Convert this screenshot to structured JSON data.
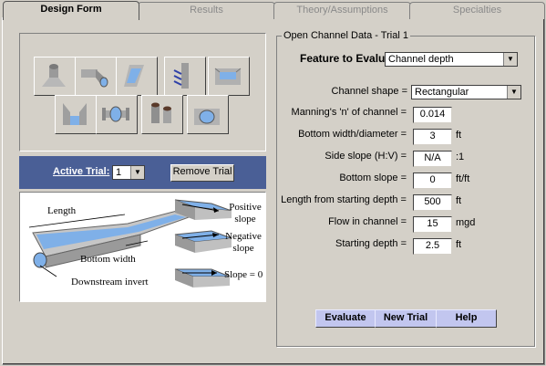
{
  "tabs": [
    {
      "label": "Design Form",
      "active": true
    },
    {
      "label": "Results",
      "active": false
    },
    {
      "label": "Theory/Assumptions",
      "active": false
    },
    {
      "label": "Specialties",
      "active": false
    }
  ],
  "icons": {
    "row1": [
      "pipe-outlet-icon",
      "angled-pipe-icon",
      "open-channel-icon",
      "weir-plate-icon",
      "box-channel-icon"
    ],
    "row2": [
      "flume-icon",
      "pipe-junction-icon",
      "manhole-icon",
      "culvert-icon"
    ]
  },
  "active_trial": {
    "label": "Active Trial:",
    "value": "1",
    "remove_label": "Remove Trial"
  },
  "diagram": {
    "length": "Length",
    "bottom_width": "Bottom width",
    "downstream_invert": "Downstream invert",
    "positive_slope": "Positive slope",
    "negative_slope": "Negative slope",
    "zero_slope": "Slope = 0"
  },
  "panel": {
    "group_title": "Open Channel Data - Trial 1",
    "feature_label": "Feature to Evaluate:",
    "feature_value": "Channel depth",
    "shape_label": "Channel shape =",
    "shape_value": "Rectangular",
    "rows": [
      {
        "label": "Manning's 'n' of channel =",
        "value": "0.014",
        "unit": ""
      },
      {
        "label": "Bottom width/diameter =",
        "value": "3",
        "unit": "ft"
      },
      {
        "label": "Side slope (H:V) =",
        "value": "N/A",
        "unit": ":1"
      },
      {
        "label": "Bottom slope =",
        "value": "0",
        "unit": "ft/ft"
      },
      {
        "label": "Length from starting depth =",
        "value": "500",
        "unit": "ft"
      },
      {
        "label": "Flow in channel =",
        "value": "15",
        "unit": "mgd"
      },
      {
        "label": "Starting depth =",
        "value": "2.5",
        "unit": "ft"
      }
    ],
    "buttons": {
      "evaluate": "Evaluate",
      "new_trial": "New Trial",
      "help": "Help"
    }
  },
  "colors": {
    "active_bar": "#4a5f96",
    "action_button": "#c2c6ef",
    "water": "#7fb0e8"
  }
}
